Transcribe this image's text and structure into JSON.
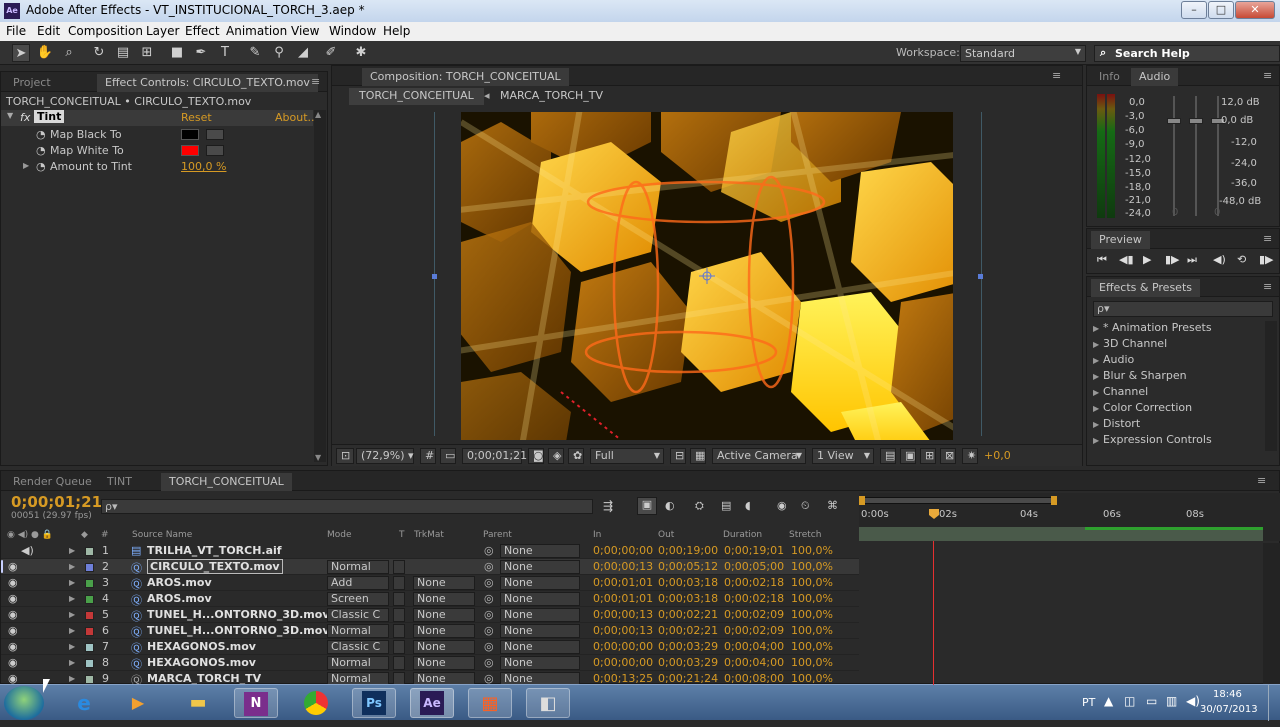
{
  "window": {
    "app_icon": "Ae",
    "title": "Adobe After Effects - VT_INSTITUCIONAL_TORCH_3.aep *",
    "minimize": "–",
    "maximize": "□",
    "close": "✕"
  },
  "menu": [
    "File",
    "Edit",
    "Composition",
    "Layer",
    "Effect",
    "Animation",
    "View",
    "Window",
    "Help"
  ],
  "toolbar": {
    "tools": [
      "selection-tool-icon",
      "hand-tool-icon",
      "zoom-tool-icon",
      "rotate-tool-icon",
      "orbit-camera-icon",
      "pan-behind-icon",
      "rectangle-tool-icon",
      "pen-tool-icon",
      "type-tool-icon",
      "brush-tool-icon",
      "clone-stamp-icon",
      "eraser-tool-icon",
      "roto-brush-icon",
      "puppet-pin-icon"
    ],
    "workspace_label": "Workspace:",
    "workspace_value": "Standard",
    "search_help": "Search Help"
  },
  "project_panel": {
    "tabs": [
      "Project",
      "Effect Controls: CIRCULO_TEXTO.mov"
    ],
    "breadcrumb": "TORCH_CONCEITUAL • CIRCULO_TEXTO.mov",
    "effect_name": "Tint",
    "reset": "Reset",
    "about": "About...",
    "params": [
      {
        "label": "Map Black To",
        "color": "#000000"
      },
      {
        "label": "Map White To",
        "color": "#ff0000"
      },
      {
        "label": "Amount to Tint",
        "value": "100,0 %"
      }
    ]
  },
  "composition_panel": {
    "tab": "Composition: TORCH_CONCEITUAL",
    "breadcrumbs": [
      "TORCH_CONCEITUAL",
      "MARCA_TORCH_TV"
    ],
    "zoom": "(72,9%)",
    "timecode": "0;00;01;21",
    "resolution": "Full",
    "camera": "Active Camera",
    "view": "1 View",
    "exposure": "+0,0"
  },
  "info_audio_panel": {
    "tabs": [
      "Info",
      "Audio"
    ],
    "left_scale": [
      "0,0",
      "-3,0",
      "-6,0",
      "-9,0",
      "-12,0",
      "-15,0",
      "-18,0",
      "-21,0",
      "-24,0"
    ],
    "right_scale": [
      "12,0 dB",
      "0,0 dB",
      "-12,0",
      "-24,0",
      "-36,0",
      "-48,0 dB"
    ],
    "zero_marks": [
      "0",
      "0"
    ]
  },
  "preview_panel": {
    "tab": "Preview",
    "buttons": [
      "first-frame-icon",
      "prev-frame-icon",
      "play-icon",
      "next-frame-icon",
      "last-frame-icon",
      "audio-icon",
      "loop-icon",
      "ram-preview-icon"
    ]
  },
  "effects_presets_panel": {
    "tab": "Effects & Presets",
    "search_placeholder": "ρ▾",
    "items": [
      "* Animation Presets",
      "3D Channel",
      "Audio",
      "Blur & Sharpen",
      "Channel",
      "Color Correction",
      "Distort",
      "Expression Controls"
    ]
  },
  "timeline_panel": {
    "tabs": [
      "Render Queue",
      "TINT",
      "TORCH_CONCEITUAL"
    ],
    "current_time": "0;00;01;21",
    "frame_info": "00051 (29.97 fps)",
    "search_placeholder": "ρ▾",
    "columns": {
      "source": "Source Name",
      "mode": "Mode",
      "t": "T",
      "trkmat": "TrkMat",
      "parent": "Parent",
      "in": "In",
      "out": "Out",
      "duration": "Duration",
      "stretch": "Stretch",
      "num": "#"
    },
    "ruler": [
      "0:00s",
      "02s",
      "04s",
      "06s",
      "08s"
    ],
    "layers": [
      {
        "num": "1",
        "name": "TRILHA_VT_TORCH.aif",
        "mode": "",
        "trkmat": "",
        "parent": "None",
        "in": "0;00;00;00",
        "out": "0;00;19;00",
        "duration": "0;00;19;01",
        "stretch": "100,0%",
        "label_color": "#9fb8a6"
      },
      {
        "num": "2",
        "name": "CIRCULO_TEXTO.mov",
        "mode": "Normal",
        "trkmat": "",
        "parent": "None",
        "in": "0;00;00;13",
        "out": "0;00;05;12",
        "duration": "0;00;05;00",
        "stretch": "100,0%",
        "label_color": "#6e7fd8"
      },
      {
        "num": "3",
        "name": "AROS.mov",
        "mode": "Add",
        "trkmat": "None",
        "parent": "None",
        "in": "0;00;01;01",
        "out": "0;00;03;18",
        "duration": "0;00;02;18",
        "stretch": "100,0%",
        "label_color": "#4aa04a"
      },
      {
        "num": "4",
        "name": "AROS.mov",
        "mode": "Screen",
        "trkmat": "None",
        "parent": "None",
        "in": "0;00;01;01",
        "out": "0;00;03;18",
        "duration": "0;00;02;18",
        "stretch": "100,0%",
        "label_color": "#4aa04a"
      },
      {
        "num": "5",
        "name": "TUNEL_H...ONTORNO_3D.mov",
        "mode": "Classic C",
        "trkmat": "None",
        "parent": "None",
        "in": "0;00;00;13",
        "out": "0;00;02;21",
        "duration": "0;00;02;09",
        "stretch": "100,0%",
        "label_color": "#c43838"
      },
      {
        "num": "6",
        "name": "TUNEL_H...ONTORNO_3D.mov",
        "mode": "Normal",
        "trkmat": "None",
        "parent": "None",
        "in": "0;00;00;13",
        "out": "0;00;02;21",
        "duration": "0;00;02;09",
        "stretch": "100,0%",
        "label_color": "#c43838"
      },
      {
        "num": "7",
        "name": "HEXAGONOS.mov",
        "mode": "Classic C",
        "trkmat": "None",
        "parent": "None",
        "in": "0;00;00;00",
        "out": "0;00;03;29",
        "duration": "0;00;04;00",
        "stretch": "100,0%",
        "label_color": "#9fc4c4"
      },
      {
        "num": "8",
        "name": "HEXAGONOS.mov",
        "mode": "Normal",
        "trkmat": "None",
        "parent": "None",
        "in": "0;00;00;00",
        "out": "0;00;03;29",
        "duration": "0;00;04;00",
        "stretch": "100,0%",
        "label_color": "#9fc4c4"
      },
      {
        "num": "9",
        "name": "MARCA_TORCH_TV",
        "mode": "Normal",
        "trkmat": "None",
        "parent": "None",
        "in": "0;00;13;25",
        "out": "0;00;21;24",
        "duration": "0;00;08;00",
        "stretch": "100,0%",
        "label_color": "#9fb8a6"
      }
    ]
  },
  "taskbar": {
    "apps": [
      "start-orb-icon",
      "internet-explorer-icon",
      "media-player-icon",
      "explorer-folder-icon",
      "onenote-icon",
      "chrome-icon",
      "photoshop-icon",
      "after-effects-icon",
      "office-icon",
      "app-icon"
    ],
    "onenote_letter": "N",
    "photoshop_letter": "Ps",
    "ae_letter": "Ae",
    "language": "PT",
    "time": "18:46",
    "date": "30/07/2013"
  }
}
